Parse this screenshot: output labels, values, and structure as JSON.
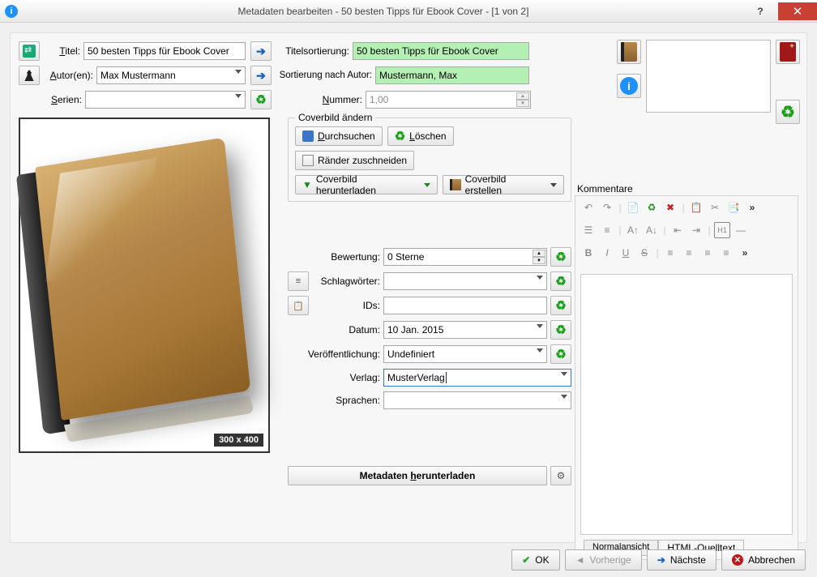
{
  "window": {
    "title": "Metadaten bearbeiten - 50 besten Tipps für Ebook Cover -   [1 von 2]"
  },
  "labels": {
    "title": "Titel:",
    "title_u": "T",
    "authors": "Autor(en):",
    "authors_u": "A",
    "series": "Serien:",
    "series_u": "S",
    "titlesort": "Titelsortierung:",
    "authorsort": "Sortierung nach Autor:",
    "number": "Nummer:",
    "number_u": "N",
    "rating": "Bewertung:",
    "tags": "Schlagwörter:",
    "ids": "IDs:",
    "date": "Datum:",
    "published": "Veröffentlichung:",
    "publisher": "Verlag:",
    "languages": "Sprachen:"
  },
  "values": {
    "title": "50 besten Tipps für Ebook Cover",
    "authors": "Max Mustermann",
    "series": "",
    "titlesort": "50 besten Tipps für Ebook Cover",
    "authorsort": "Mustermann, Max",
    "number": "1,00",
    "rating": "0 Sterne",
    "tags": "",
    "ids": "",
    "date": "10 Jan. 2015",
    "published": "Undefiniert",
    "publisher": "MusterVerlag",
    "languages": ""
  },
  "cover": {
    "group_title": "Coverbild ändern",
    "browse": "Durchsuchen",
    "delete": "Löschen",
    "trim": "Ränder zuschneiden",
    "download": "Coverbild herunterladen",
    "generate": "Coverbild erstellen",
    "size_badge": "300 x 400"
  },
  "meta_download": "Metadaten herunterladen",
  "comments": {
    "title": "Kommentare",
    "tab_normal": "Normalansicht",
    "tab_html": "HTML-Quelltext"
  },
  "bottom": {
    "ok": "OK",
    "prev": "Vorherige",
    "next": "Nächste",
    "cancel": "Abbrechen"
  }
}
